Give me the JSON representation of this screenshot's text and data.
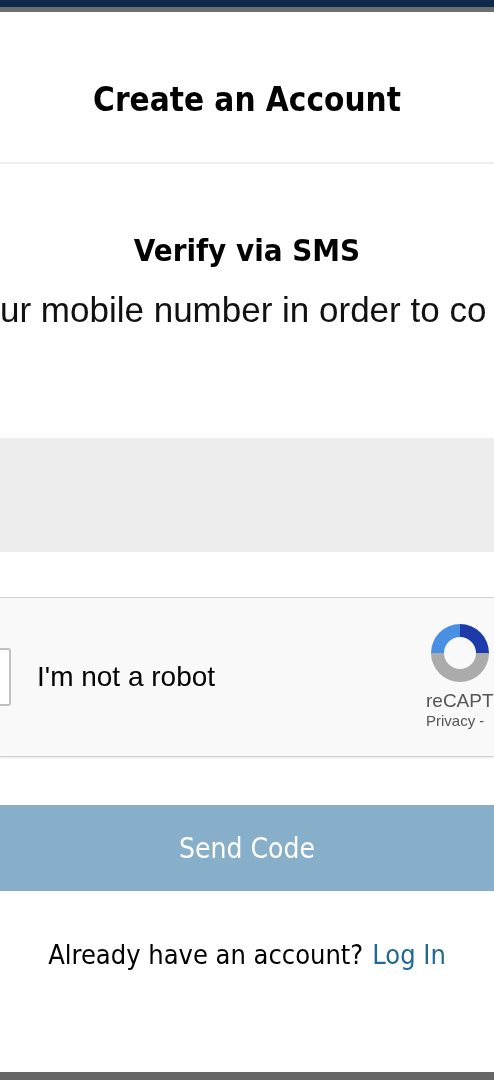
{
  "header": {
    "title": "Create an Account"
  },
  "verify": {
    "heading": "Verify via SMS",
    "description": "ur mobile number in order to co"
  },
  "captcha": {
    "checked": false,
    "label": "I'm not a robot",
    "brand": "reCAPT",
    "links": "Privacy -"
  },
  "send_button": {
    "label": "Send Code",
    "disabled": true
  },
  "footer": {
    "prompt": "Already have an account?",
    "link": "Log In"
  }
}
